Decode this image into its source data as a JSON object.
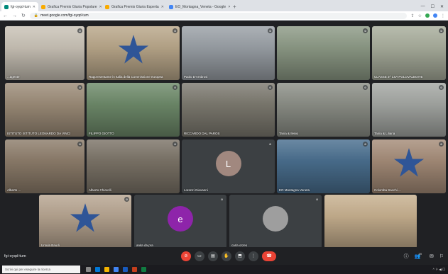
{
  "browser": {
    "tabs": [
      {
        "title": "fgi-oyqd-tum",
        "active": true,
        "favicon": "#00897b"
      },
      {
        "title": "Grafica Premio Giuria Popolare",
        "active": false,
        "favicon": "#f9ab00"
      },
      {
        "title": "Grafica Premio Giuria Esperta",
        "active": false,
        "favicon": "#f9ab00"
      },
      {
        "title": "EO_Montagna_Veneta - Google",
        "active": false,
        "favicon": "#4285f4"
      }
    ],
    "new_tab_icon": "plus-icon",
    "url": "meet.google.com/fgi-oyqd-tum"
  },
  "tiles": [
    {
      "name": "...agente",
      "mic": "mic-off-icon",
      "bg": "#c9c2b6"
    },
    {
      "name": "Rappresentante in Italia della Commissione europea",
      "mic": "mic-off-icon",
      "bg": "#b9a78a",
      "star": true
    },
    {
      "name": "Paolo D'Ambrosi",
      "mic": "mic-off-icon",
      "bg": "#9aa0a6"
    },
    {
      "name": "",
      "mic": "mic-off-icon",
      "bg": "#8d9a86"
    },
    {
      "name": "CLASSE 3^ LSA POLOVALBOITE",
      "mic": "mic-off-icon",
      "bg": "#a8ad9c"
    },
    {
      "name": "ISTITUTO ISTITUTO LEONARDO DA VINCI",
      "mic": "mic-off-icon",
      "bg": "#9c8c78"
    },
    {
      "name": "FILIPPO GIOTTO",
      "mic": "mic-off-icon",
      "bg": "#6e8a6a"
    },
    {
      "name": "RICCARDO DAL PAROS",
      "mic": "mic-off-icon",
      "bg": "#7d7a70"
    },
    {
      "name": "Tania & Ilenio",
      "mic": "mic-off-icon",
      "bg": "#8c8f87"
    },
    {
      "name": "Tania & Liliana",
      "mic": "mic-off-icon",
      "bg": "#a4a7a3"
    },
    {
      "name": "Alberto ...",
      "mic": "mic-off-icon",
      "bg": "#8d7d6b"
    },
    {
      "name": "Alberto Chiarelli",
      "mic": "mic-off-icon",
      "bg": "#7c7468"
    },
    {
      "name": "Lorenzi Giovanni",
      "mic": "mic-off-icon",
      "bg": "#3c4043",
      "initial": "L",
      "avatar": "#a1887f"
    },
    {
      "name": "EO Montagna Veneta",
      "mic": "mic-off-icon",
      "bg": "#4a6f8f"
    },
    {
      "name": "Colomba Sacchi ...",
      "mic": "mic-off-icon",
      "bg": "#a58c78",
      "star": true
    },
    {
      "name": "Ursula Baudi",
      "mic": "mic-off-icon",
      "bg": "#b7a591",
      "star": true
    },
    {
      "name": "anita da pra",
      "mic": "mic-off-icon",
      "bg": "#3c4043",
      "initial": "e",
      "avatar": "#8e24aa"
    },
    {
      "name": "carla orzes",
      "mic": "mic-off-icon",
      "bg": "#3c4043",
      "initial": "",
      "avatar": "#9e9e9e"
    },
    {
      "name": "",
      "mic": "",
      "bg": "#c7b08f"
    }
  ],
  "meeting": {
    "code": "fgi-oyqd-tum",
    "controls": [
      {
        "icon": "mic-off-icon",
        "red": true
      },
      {
        "icon": "camera-icon",
        "red": false
      },
      {
        "icon": "captions-icon",
        "red": false
      },
      {
        "icon": "hand-icon",
        "red": false
      },
      {
        "icon": "present-icon",
        "red": false
      },
      {
        "icon": "more-icon",
        "red": false
      }
    ],
    "hangup_icon": "phone-hangup-icon",
    "right": {
      "info": "ⓘ",
      "people": "👥",
      "people_count": "19",
      "chat": "✉",
      "activities": "⚐"
    }
  },
  "taskbar": {
    "search_placeholder": "Scrivi qui per eseguire la ricerca",
    "time": "^ ⚐ ◀ ☐"
  }
}
